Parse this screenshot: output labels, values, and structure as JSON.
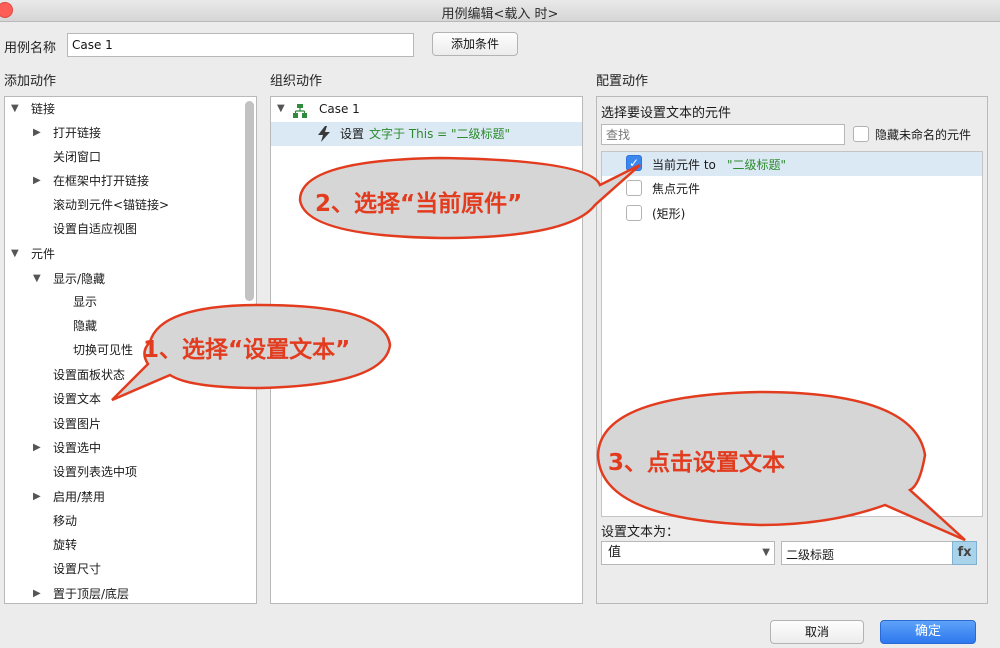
{
  "window": {
    "title": "用例编辑<载入 时>"
  },
  "case_name": {
    "label": "用例名称",
    "value": "Case 1",
    "add_condition": "添加条件"
  },
  "sections": {
    "add": "添加动作",
    "organize": "组织动作",
    "configure": "配置动作"
  },
  "add_actions": {
    "group_links": "链接",
    "open_link": "打开链接",
    "close_window": "关闭窗口",
    "open_in_frame": "在框架中打开链接",
    "scroll_to_widget": "滚动到元件<锚链接>",
    "set_adaptive_view": "设置自适应视图",
    "group_widgets": "元件",
    "show_hide": "显示/隐藏",
    "show": "显示",
    "hide": "隐藏",
    "toggle_visibility": "切换可见性",
    "set_panel_state": "设置面板状态",
    "set_text": "设置文本",
    "set_image": "设置图片",
    "set_selected": "设置选中",
    "set_list_selected": "设置列表选中项",
    "enable_disable": "启用/禁用",
    "move": "移动",
    "rotate": "旋转",
    "set_size": "设置尺寸",
    "bring_front_back": "置于顶层/底层"
  },
  "organize": {
    "case_label": "Case 1",
    "action_prefix": "设置 ",
    "action_detail": "文字于 This = \"二级标题\""
  },
  "configure": {
    "subtitle": "选择要设置文本的元件",
    "search_placeholder": "查找",
    "hide_unnamed": "隐藏未命名的元件",
    "widgets": [
      {
        "label_prefix": "当前元件 to ",
        "label_value": "\"二级标题\"",
        "checked": true
      },
      {
        "label_prefix": "焦点元件",
        "label_value": "",
        "checked": false
      },
      {
        "label_prefix": "(矩形)",
        "label_value": "",
        "checked": false
      }
    ],
    "set_text_to": "设置文本为：",
    "value_type": "值",
    "value_text": "二级标题",
    "fx": "fx"
  },
  "buttons": {
    "cancel": "取消",
    "ok": "确定"
  },
  "callouts": {
    "one": "1、选择“设置文本”",
    "two": "2、选择“当前原件”",
    "three": "3、点击设置文本"
  },
  "colors": {
    "callout_fill": "#d6d6d6",
    "callout_stroke": "#e23b1e",
    "primary": "#2d78ee"
  }
}
